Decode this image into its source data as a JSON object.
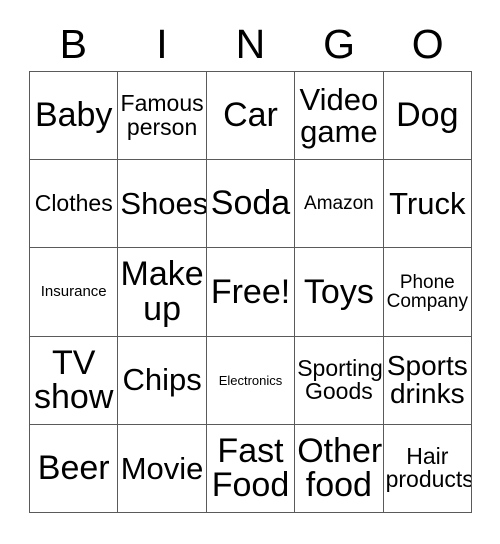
{
  "card": {
    "title": "BINGO",
    "header_letters": [
      "B",
      "I",
      "N",
      "G",
      "O"
    ],
    "border_color": "#5a5a5a",
    "text_color": "#000000",
    "background_color": "#ffffff",
    "columns": 5,
    "rows": 5,
    "free_space_index": 12,
    "cells": [
      {
        "label": "Baby",
        "size": "xxl"
      },
      {
        "label": "Famous\nperson",
        "size": "md"
      },
      {
        "label": "Car",
        "size": "xxl"
      },
      {
        "label": "Video\ngame",
        "size": "xl"
      },
      {
        "label": "Dog",
        "size": "xxl"
      },
      {
        "label": "Clothes",
        "size": "md"
      },
      {
        "label": "Shoes",
        "size": "xl"
      },
      {
        "label": "Soda",
        "size": "xxl"
      },
      {
        "label": "Amazon",
        "size": "sm"
      },
      {
        "label": "Truck",
        "size": "xl"
      },
      {
        "label": "Insurance",
        "size": "xs"
      },
      {
        "label": "Make\nup",
        "size": "xxl"
      },
      {
        "label": "Free!",
        "size": "xxl"
      },
      {
        "label": "Toys",
        "size": "xxl"
      },
      {
        "label": "Phone\nCompany",
        "size": "sm"
      },
      {
        "label": "TV\nshow",
        "size": "xxl"
      },
      {
        "label": "Chips",
        "size": "xl"
      },
      {
        "label": "Electronics",
        "size": "xxs"
      },
      {
        "label": "Sporting\nGoods",
        "size": "md"
      },
      {
        "label": "Sports\ndrinks",
        "size": "lg"
      },
      {
        "label": "Beer",
        "size": "xxl"
      },
      {
        "label": "Movie",
        "size": "xl"
      },
      {
        "label": "Fast\nFood",
        "size": "xxl"
      },
      {
        "label": "Other\nfood",
        "size": "xxl"
      },
      {
        "label": "Hair\nproducts",
        "size": "md"
      }
    ]
  }
}
